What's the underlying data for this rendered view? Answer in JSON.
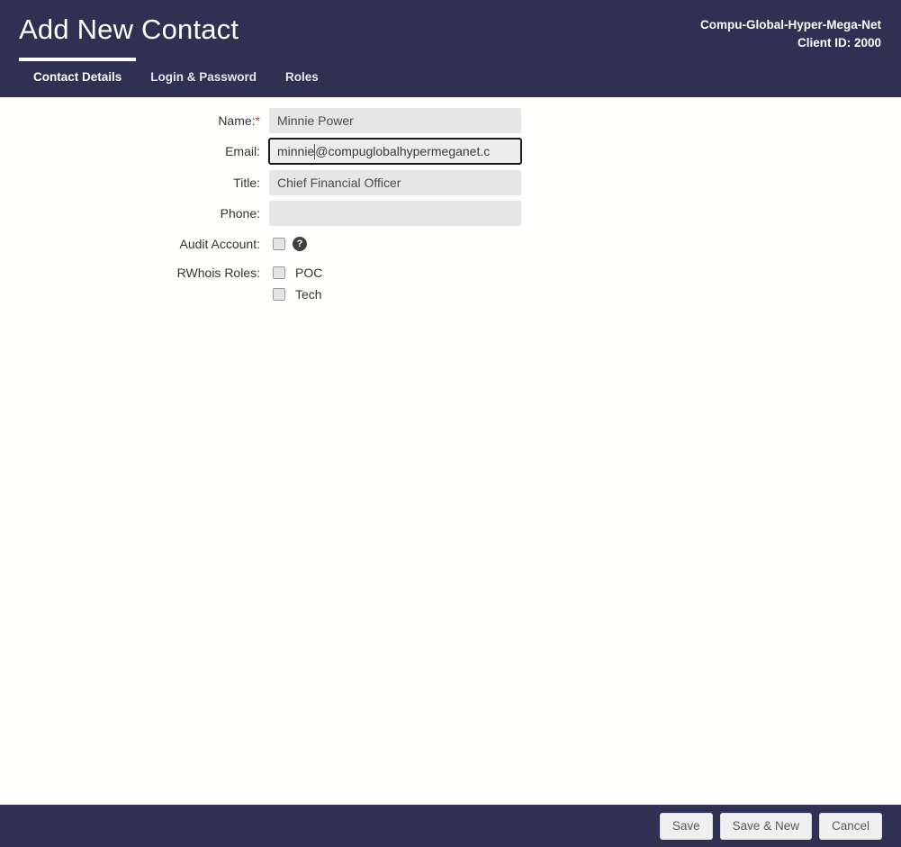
{
  "header": {
    "title": "Add New Contact",
    "org_name": "Compu-Global-Hyper-Mega-Net",
    "client_id": "Client ID: 2000",
    "tabs": [
      {
        "label": "Contact Details",
        "active": true
      },
      {
        "label": "Login & Password",
        "active": false
      },
      {
        "label": "Roles",
        "active": false
      }
    ]
  },
  "form": {
    "name": {
      "label": "Name:",
      "required_marker": "*",
      "value": "Minnie Power",
      "placeholder": ""
    },
    "email": {
      "label": "Email:",
      "value_before_caret": "minnie",
      "value_after_caret": "@compuglobalhypermeganet.c",
      "full_value": "minnie@compuglobalhypermeganet.c",
      "placeholder": "",
      "focused": true
    },
    "title": {
      "label": "Title:",
      "value": "Chief Financial Officer",
      "placeholder": ""
    },
    "phone": {
      "label": "Phone:",
      "value": "",
      "placeholder": ""
    },
    "audit_account": {
      "label": "Audit Account:",
      "checked": false,
      "help_icon": "question-mark-icon",
      "help_glyph": "?"
    },
    "rwhois_roles": {
      "label": "RWhois Roles:",
      "options": [
        {
          "label": "POC",
          "checked": false
        },
        {
          "label": "Tech",
          "checked": false
        }
      ]
    }
  },
  "footer": {
    "buttons": [
      {
        "label": "Save",
        "name": "save-button"
      },
      {
        "label": "Save & New",
        "name": "save-and-new-button"
      },
      {
        "label": "Cancel",
        "name": "cancel-button"
      }
    ]
  },
  "colors": {
    "header_bg": "#2f3052",
    "page_bg": "#fffffd",
    "input_bg": "#e6e6e6",
    "required_red": "#c0392b",
    "button_bg": "#f0f0f0"
  }
}
